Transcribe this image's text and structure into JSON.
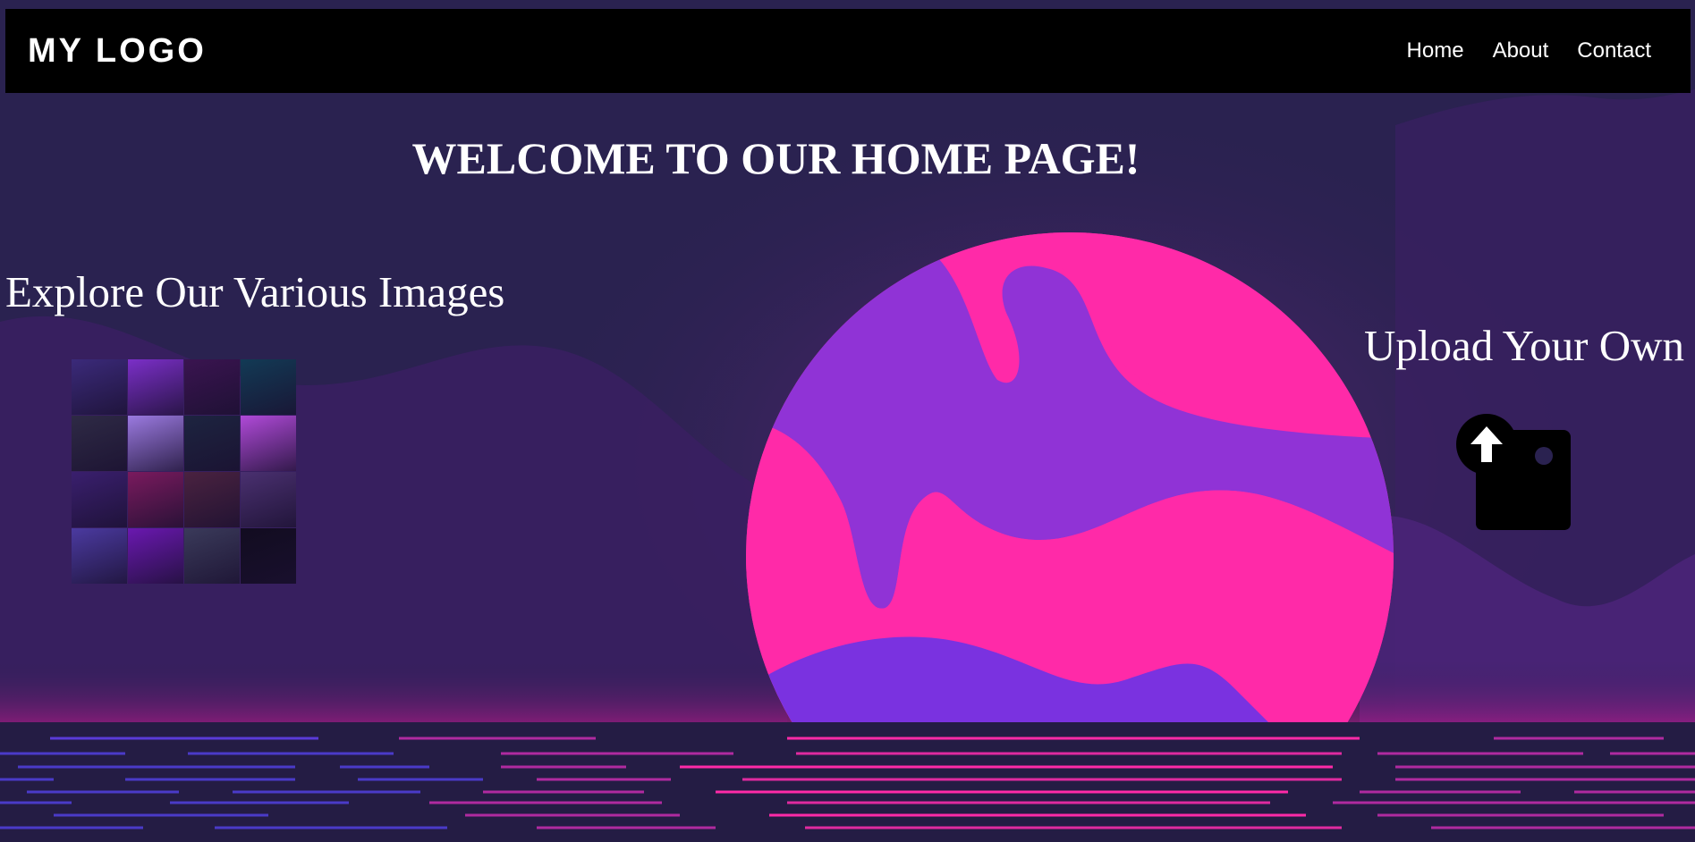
{
  "header": {
    "logo": "MY LOGO",
    "nav": [
      {
        "label": "Home"
      },
      {
        "label": "About"
      },
      {
        "label": "Contact"
      }
    ]
  },
  "hero": {
    "title": "WELCOME TO OUR HOME PAGE!"
  },
  "gallery": {
    "title": "Explore Our Various Images",
    "thumbnail_colors": [
      "#3b2a7a",
      "#7b2fc8",
      "#3a1450",
      "#123a55",
      "#2e2a45",
      "#9b7ae0",
      "#1d2440",
      "#b04ad8",
      "#3a1f6e",
      "#7a1a5e",
      "#4a2240",
      "#4a3070",
      "#4b3aa0",
      "#6a18b0",
      "#3a3a5a",
      "#120c20"
    ]
  },
  "upload": {
    "title": "Upload Your Own",
    "icon": "upload-image-icon"
  },
  "colors": {
    "navbar": "#000000",
    "background": "#2a2250",
    "sun_pink": "#ff2aa8",
    "sun_violet": "#7a32e0"
  }
}
